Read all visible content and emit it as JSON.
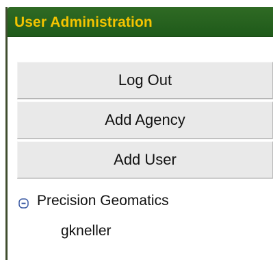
{
  "panel": {
    "title": "User Administration",
    "colors": {
      "header_bg": "#236321",
      "title_text": "#F4C400",
      "button_bg": "#E9E9E9",
      "toggle_color": "#3B5AA3"
    }
  },
  "actions": {
    "logout_label": "Log Out",
    "add_agency_label": "Add Agency",
    "add_user_label": "Add User"
  },
  "tree": {
    "agency": {
      "toggle_icon": "minus-box-icon",
      "label": "Precision Geomatics",
      "users": [
        "gkneller"
      ]
    }
  }
}
